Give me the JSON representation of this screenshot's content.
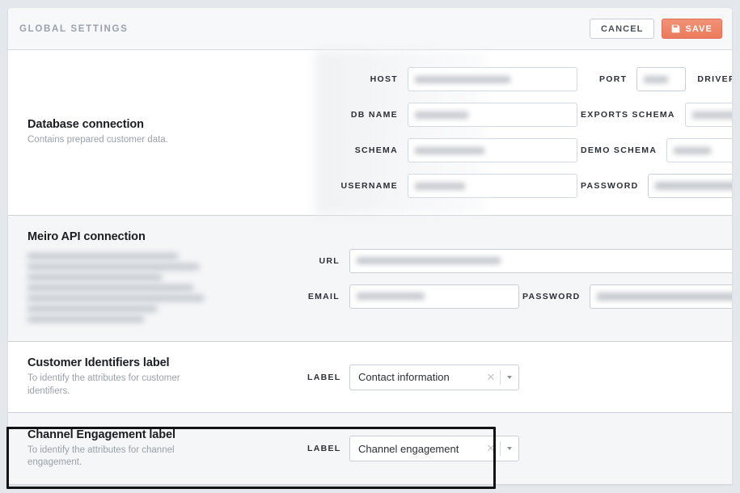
{
  "header": {
    "title": "GLOBAL SETTINGS",
    "cancel_label": "CANCEL",
    "save_label": "SAVE",
    "save_icon": "save-disk-icon",
    "accent_color": "#ec7a5c",
    "background": "#f7f8fa"
  },
  "sections": [
    {
      "id": "database-connection",
      "title": "Database connection",
      "description": "Contains prepared customer data.",
      "background": "#ffffff",
      "fields": [
        {
          "label": "HOST",
          "value": "",
          "redacted": true,
          "type": "text"
        },
        {
          "label": "PORT",
          "value": "",
          "redacted": true,
          "type": "text"
        },
        {
          "label": "DRIVER",
          "value": "",
          "redacted": true,
          "type": "select"
        },
        {
          "label": "DB NAME",
          "value": "",
          "redacted": true,
          "type": "text"
        },
        {
          "label": "EXPORTS SCHEMA",
          "value": "",
          "redacted": true,
          "type": "text"
        },
        {
          "label": "SCHEMA",
          "value": "",
          "redacted": true,
          "type": "text"
        },
        {
          "label": "DEMO SCHEMA",
          "value": "",
          "redacted": true,
          "type": "text"
        },
        {
          "label": "USERNAME",
          "value": "",
          "redacted": true,
          "type": "text"
        },
        {
          "label": "PASSWORD",
          "value": "",
          "redacted": true,
          "type": "password",
          "icon": "eye-icon"
        }
      ]
    },
    {
      "id": "meiro-api-connection",
      "title": "Meiro API connection",
      "description": "",
      "description_redacted": true,
      "background": "#f4f6f8",
      "fields": [
        {
          "label": "URL",
          "value": "",
          "redacted": true,
          "type": "text"
        },
        {
          "label": "EMAIL",
          "value": "",
          "redacted": true,
          "type": "text"
        },
        {
          "label": "PASSWORD",
          "value": "",
          "redacted": true,
          "type": "password",
          "icon": "eye-icon"
        }
      ]
    },
    {
      "id": "customer-identifiers-label",
      "title": "Customer Identifiers label",
      "description": "To identify the attributes for customer identifiers.",
      "background": "#ffffff",
      "highlighted": false,
      "fields": [
        {
          "label": "LABEL",
          "value": "Contact information",
          "redacted": false,
          "type": "select",
          "clear_icon": "close-icon",
          "caret_icon": "chevron-down-icon"
        }
      ]
    },
    {
      "id": "channel-engagement-label",
      "title": "Channel Engagement label",
      "description": "To identify the attributes for channel engagement.",
      "background": "#f4f6f8",
      "highlighted": true,
      "highlight_color": "#111315",
      "fields": [
        {
          "label": "LABEL",
          "value": "Channel engagement",
          "redacted": false,
          "type": "select",
          "clear_icon": "close-icon",
          "caret_icon": "chevron-down-icon"
        }
      ]
    }
  ]
}
